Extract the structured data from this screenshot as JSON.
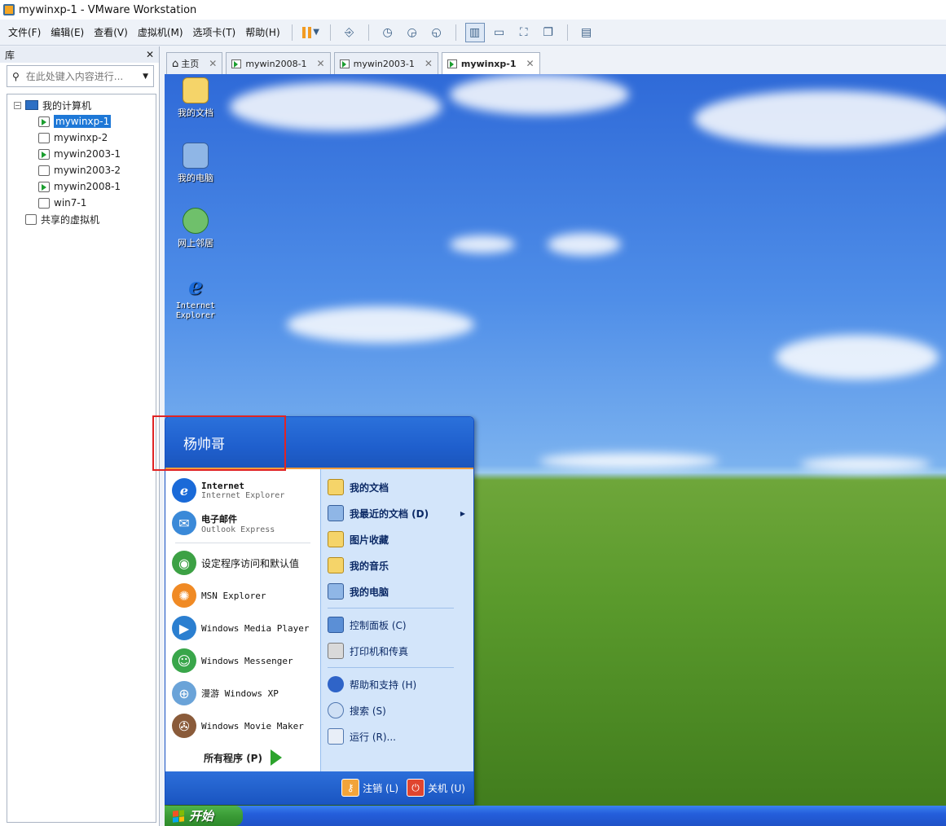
{
  "window": {
    "title": "mywinxp-1 - VMware Workstation"
  },
  "menu": [
    "文件(F)",
    "编辑(E)",
    "查看(V)",
    "虚拟机(M)",
    "选项卡(T)",
    "帮助(H)"
  ],
  "library": {
    "title": "库",
    "close": "✕",
    "search_placeholder": "在此处键入内容进行...",
    "root": "我的计算机",
    "vms": [
      {
        "label": "mywinxp-1",
        "running": true,
        "selected": true
      },
      {
        "label": "mywinxp-2",
        "running": false,
        "selected": false
      },
      {
        "label": "mywin2003-1",
        "running": true,
        "selected": false
      },
      {
        "label": "mywin2003-2",
        "running": false,
        "selected": false
      },
      {
        "label": "mywin2008-1",
        "running": true,
        "selected": false
      },
      {
        "label": "win7-1",
        "running": false,
        "selected": false
      }
    ],
    "shared": "共享的虚拟机"
  },
  "tabs": [
    {
      "label": "主页",
      "close": "✕"
    },
    {
      "label": "mywin2008-1",
      "close": "✕"
    },
    {
      "label": "mywin2003-1",
      "close": "✕"
    },
    {
      "label": "mywinxp-1",
      "close": "✕"
    }
  ],
  "desktop": {
    "icons": [
      {
        "label": "我的文档"
      },
      {
        "label": "我的电脑"
      },
      {
        "label": "网上邻居"
      },
      {
        "label": "Internet Explorer"
      }
    ]
  },
  "start_menu": {
    "user": "杨帅哥",
    "pinned": [
      {
        "title": "Internet",
        "subtitle": "Internet Explorer"
      },
      {
        "title": "电子邮件",
        "subtitle": "Outlook Express"
      }
    ],
    "recent": [
      "设定程序访问和默认值",
      "MSN Explorer",
      "Windows Media Player",
      "Windows Messenger",
      "漫游 Windows XP",
      "Windows Movie Maker"
    ],
    "all_programs": "所有程序 (P)",
    "right": {
      "group1": [
        "我的文档",
        "我最近的文档 (D)",
        "图片收藏",
        "我的音乐",
        "我的电脑"
      ],
      "group2": [
        "控制面板 (C)",
        "打印机和传真"
      ],
      "group3": [
        "帮助和支持 (H)",
        "搜索 (S)",
        "运行 (R)..."
      ]
    },
    "logoff": "注销 (L)",
    "shutdown": "关机 (U)"
  },
  "taskbar": {
    "start": "开始"
  },
  "colors": {
    "xp_blue": "#245edb",
    "start_green": "#3a9b36",
    "highlight_red": "#e02424",
    "selection": "#1e78d7"
  }
}
